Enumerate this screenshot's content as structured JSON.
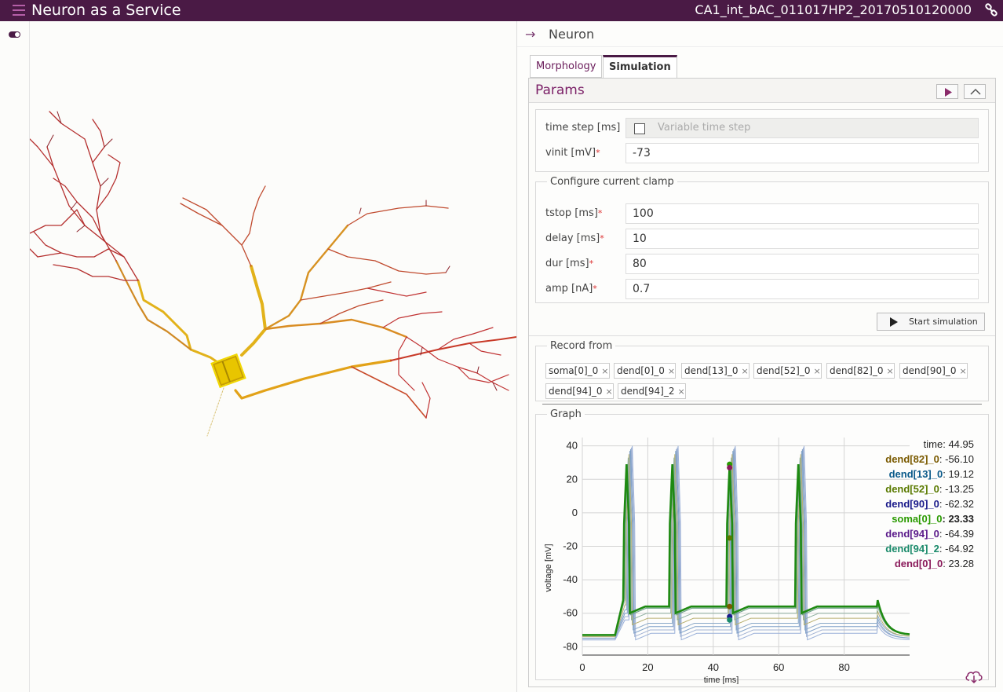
{
  "header": {
    "app_title": "Neuron as a Service",
    "model_name": "CA1_int_bAC_011017HP2_20170510120000"
  },
  "panel": {
    "title": "Neuron"
  },
  "tabs": [
    {
      "label": "Morphology"
    },
    {
      "label": "Simulation"
    }
  ],
  "params": {
    "title": "Params",
    "time_step_label": "time step [ms]",
    "variable_time_step_label": "Variable time step",
    "vinit_label": "vinit [mV]",
    "vinit_value": "-73"
  },
  "clamp": {
    "legend": "Configure current clamp",
    "fields": [
      {
        "label": "tstop [ms]",
        "value": "100"
      },
      {
        "label": "delay [ms]",
        "value": "10"
      },
      {
        "label": "dur [ms]",
        "value": "80"
      },
      {
        "label": "amp [nA]",
        "value": "0.7"
      }
    ],
    "start_label": "Start simulation"
  },
  "record": {
    "legend": "Record from",
    "chips": [
      "soma[0]_0",
      "dend[0]_0",
      "dend[13]_0",
      "dend[52]_0",
      "dend[82]_0",
      "dend[90]_0",
      "dend[94]_0",
      "dend[94]_2"
    ]
  },
  "graph": {
    "legend": "Graph",
    "time_label": "time",
    "time_value": "44.95",
    "readouts": [
      {
        "name": "dend[82]_0",
        "value": "-56.10",
        "color": "#7a5a00"
      },
      {
        "name": "dend[13]_0",
        "value": "19.12",
        "color": "#0a5a8a"
      },
      {
        "name": "dend[52]_0",
        "value": "-13.25",
        "color": "#5a7a00"
      },
      {
        "name": "dend[90]_0",
        "value": "-62.32",
        "color": "#1a1a8a"
      },
      {
        "name": "soma[0]_0",
        "value": "23.33",
        "color": "#2a9a00"
      },
      {
        "name": "dend[94]_0",
        "value": "-64.39",
        "color": "#5a1a8a"
      },
      {
        "name": "dend[94]_2",
        "value": "-64.92",
        "color": "#1a8a6a"
      },
      {
        "name": "dend[0]_0",
        "value": "23.28",
        "color": "#8a1a5a"
      }
    ]
  },
  "chart_data": {
    "type": "line",
    "xlabel": "time [ms]",
    "ylabel": "voltage [mV]",
    "xlim": [
      0,
      100
    ],
    "ylim": [
      -85,
      45
    ],
    "xticks": [
      0,
      20,
      40,
      60,
      80
    ],
    "yticks": [
      40,
      20,
      0,
      -20,
      -40,
      -60,
      -80
    ],
    "cursor_time": 45,
    "spike_times": [
      13.5,
      27.5,
      45,
      66
    ],
    "series": [
      {
        "name": "soma[0]_0",
        "baseline": -73,
        "plateau": -56,
        "peak": 29,
        "color": "#1e8a12",
        "width": 2.6
      },
      {
        "name": "dend[0]_0",
        "baseline": -73,
        "plateau": -57,
        "peak": 29,
        "color": "#6fa08a",
        "width": 1.2
      },
      {
        "name": "dend[82]_0",
        "baseline": -73,
        "plateau": -60,
        "peak": 33,
        "color": "#8fb0a0",
        "width": 1.0
      },
      {
        "name": "dend[52]_0",
        "baseline": -74,
        "plateau": -63,
        "peak": 35,
        "color": "#b8b070",
        "width": 1.0
      },
      {
        "name": "dend[90]_0",
        "baseline": -74,
        "plateau": -66,
        "peak": 37,
        "color": "#8aa8c8",
        "width": 1.0
      },
      {
        "name": "dend[13]_0",
        "baseline": -75,
        "plateau": -68,
        "peak": 38,
        "color": "#7fa0c8",
        "width": 1.0
      },
      {
        "name": "dend[94]_0",
        "baseline": -75,
        "plateau": -70,
        "peak": 39,
        "color": "#a4b4d4",
        "width": 1.0
      },
      {
        "name": "dend[94]_2",
        "baseline": -76,
        "plateau": -72,
        "peak": 40,
        "color": "#9ab0d8",
        "width": 1.0
      }
    ]
  },
  "colors": {
    "brand": "#4a1a45",
    "accent": "#7a1e66"
  },
  "icons": [
    "menu-icon",
    "link-icon",
    "toggle-icon",
    "collapse-arrow-icon",
    "play-icon",
    "chevron-up-icon",
    "download-icon"
  ]
}
